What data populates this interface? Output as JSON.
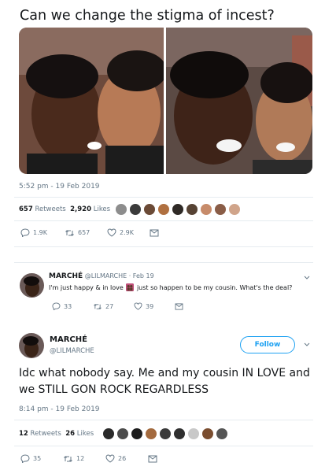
{
  "header": {
    "title": "Can we change the stigma of incest?"
  },
  "first_tweet": {
    "timestamp": "5:52 pm - 19 Feb 2019",
    "stats": {
      "retweets_count": "657",
      "retweets_label": "Retweets",
      "likes_count": "2,920",
      "likes_label": "Likes"
    },
    "actions": {
      "replies": "1.9K",
      "retweets": "657",
      "likes": "2.9K"
    },
    "avatar_colors": [
      "#8d8d8d",
      "#3b3b3b",
      "#6b4a36",
      "#b07040",
      "#2f2a26",
      "#574334",
      "#c78b6a",
      "#8a5d47",
      "#d0a48a"
    ]
  },
  "reply_tweet": {
    "author_name": "MARCHÉ",
    "author_handle": "@LILMARCHE",
    "separator": "·",
    "date": "Feb 19",
    "text_before_emoji": "I'm just happy & in love",
    "text_after_emoji": "just so happen to be my cousin. What's the deal?",
    "actions": {
      "replies": "33",
      "retweets": "27",
      "likes": "39"
    }
  },
  "main_tweet": {
    "author_name": "MARCHÉ",
    "author_handle": "@LILMARCHE",
    "follow_label": "Follow",
    "text": "Idc what nobody say. Me and my cousin IN LOVE and we STILL GON ROCK REGARDLESS",
    "timestamp": "8:14 pm - 19 Feb 2019",
    "stats": {
      "retweets_count": "12",
      "retweets_label": "Retweets",
      "likes_count": "26",
      "likes_label": "Likes"
    },
    "actions": {
      "replies": "35",
      "retweets": "12",
      "likes": "26"
    },
    "avatar_colors": [
      "#2a2a2a",
      "#4b4b4b",
      "#1d1d1d",
      "#a36a3e",
      "#3a3a3a",
      "#2f2f2f",
      "#c8c8c8",
      "#7a4d2f",
      "#555555"
    ]
  },
  "colors": {
    "accent": "#1da1f2",
    "muted": "#657786",
    "text": "#14171a",
    "divider": "#e6ecf0"
  }
}
